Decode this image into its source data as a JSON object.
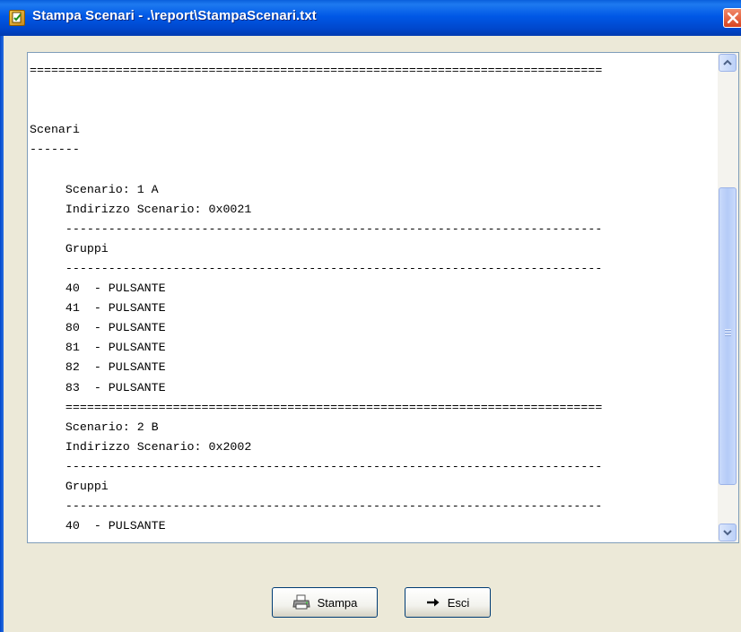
{
  "window": {
    "title": "Stampa Scenari - .\\report\\StampaScenari.txt",
    "app_icon": "report-icon",
    "close_icon": "close-icon"
  },
  "report": {
    "lines": [
      "================================================================================",
      "",
      "",
      "Scenari",
      "-------",
      "",
      "     Scenario: 1 A",
      "     Indirizzo Scenario: 0x0021",
      "     ---------------------------------------------------------------------------",
      "     Gruppi",
      "     ---------------------------------------------------------------------------",
      "     40  - PULSANTE",
      "     41  - PULSANTE",
      "     80  - PULSANTE",
      "     81  - PULSANTE",
      "     82  - PULSANTE",
      "     83  - PULSANTE",
      "     ===========================================================================",
      "     Scenario: 2 B",
      "     Indirizzo Scenario: 0x2002",
      "     ---------------------------------------------------------------------------",
      "     Gruppi",
      "     ---------------------------------------------------------------------------",
      "     40  - PULSANTE"
    ]
  },
  "buttons": {
    "print_label": "Stampa",
    "print_icon": "printer-icon",
    "exit_label": "Esci",
    "exit_icon": "arrow-right-icon"
  },
  "colors": {
    "titlebar": "#0058E6",
    "dialog_background": "#ECE9D8",
    "scrollbar_thumb": "#B5CBF7",
    "button_border": "#003C74"
  }
}
